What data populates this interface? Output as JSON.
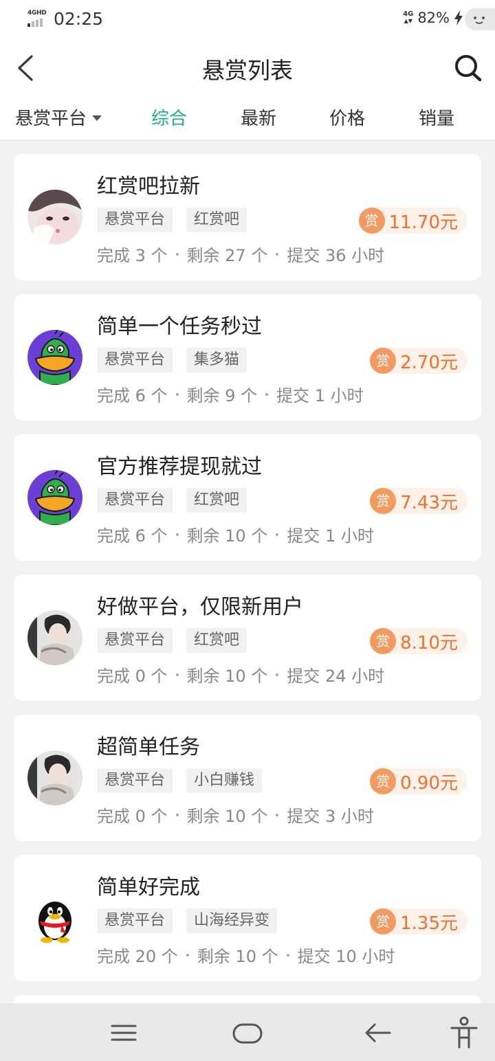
{
  "status_bar": {
    "network": "4GHD",
    "time": "02:25",
    "lte": "4G",
    "battery": "82%"
  },
  "header": {
    "title": "悬赏列表"
  },
  "filter": {
    "platform_label": "悬赏平台",
    "tabs": [
      {
        "label": "综合",
        "active": true
      },
      {
        "label": "最新",
        "active": false
      },
      {
        "label": "价格",
        "active": false
      },
      {
        "label": "销量",
        "active": false
      }
    ],
    "accent_color": "#1fae90"
  },
  "reward_badge": "赏",
  "tasks": [
    {
      "title": "红赏吧拉新",
      "avatar": "girl-photo",
      "tags": [
        "悬赏平台",
        "红赏吧"
      ],
      "reward": "11.70元",
      "done": "完成 3 个",
      "left": "剩余 27 个",
      "submit": "提交 36 小时"
    },
    {
      "title": "简单一个任务秒过",
      "avatar": "green-duck",
      "tags": [
        "悬赏平台",
        "集多猫"
      ],
      "reward": "2.70元",
      "done": "完成 6 个",
      "left": "剩余 9 个",
      "submit": "提交 1 小时"
    },
    {
      "title": "官方推荐提现就过",
      "avatar": "green-duck",
      "tags": [
        "悬赏平台",
        "红赏吧"
      ],
      "reward": "7.43元",
      "done": "完成 6 个",
      "left": "剩余 10 个",
      "submit": "提交 1 小时"
    },
    {
      "title": "好做平台，仅限新用户",
      "avatar": "boy-photo",
      "tags": [
        "悬赏平台",
        "红赏吧"
      ],
      "reward": "8.10元",
      "done": "完成 0 个",
      "left": "剩余 10 个",
      "submit": "提交 24 小时"
    },
    {
      "title": "超简单任务",
      "avatar": "boy-photo",
      "tags": [
        "悬赏平台",
        "小白赚钱"
      ],
      "reward": "0.90元",
      "done": "完成 0 个",
      "left": "剩余 10 个",
      "submit": "提交 3 小时"
    },
    {
      "title": "简单好完成",
      "avatar": "qq-penguin",
      "tags": [
        "悬赏平台",
        "山海经异变"
      ],
      "reward": "1.35元",
      "done": "完成 20 个",
      "left": "剩余 10 个",
      "submit": "提交 10 小时"
    }
  ],
  "colors": {
    "reward_text": "#f0702b",
    "reward_badge_bg": "#f59a5f",
    "reward_pill_bg": "#fdf1e8"
  },
  "nav_bar": {
    "buttons": [
      "menu-icon",
      "home-icon",
      "back-arrow-icon",
      "accessibility-icon"
    ]
  }
}
